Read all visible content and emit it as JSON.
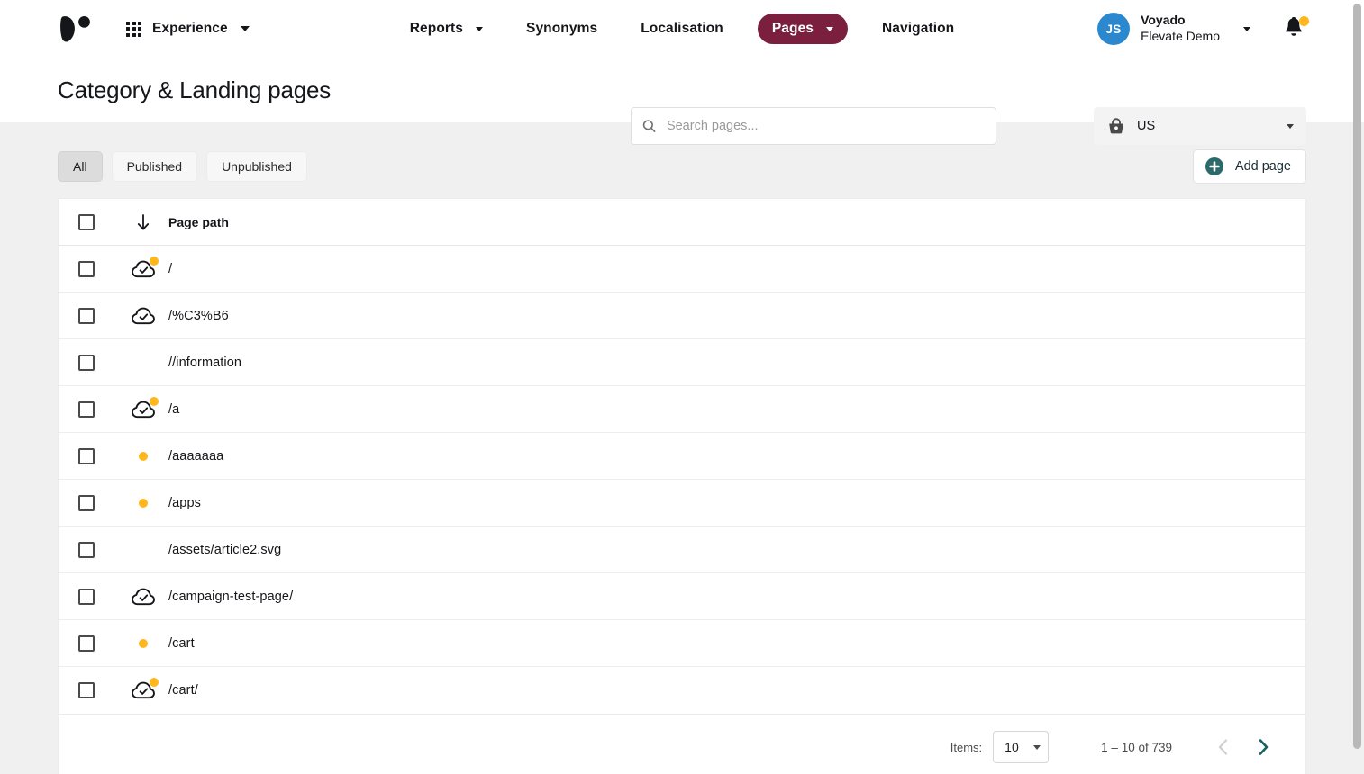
{
  "topbar": {
    "logo_name": "voyado-logo",
    "app_switcher": {
      "label": "Experience"
    },
    "nav": [
      {
        "label": "Reports",
        "has_caret": true,
        "active": false
      },
      {
        "label": "Synonyms",
        "has_caret": false,
        "active": false
      },
      {
        "label": "Localisation",
        "has_caret": false,
        "active": false
      },
      {
        "label": "Pages",
        "has_caret": true,
        "active": true
      },
      {
        "label": "Navigation",
        "has_caret": false,
        "active": false
      }
    ],
    "user": {
      "initials": "JS",
      "org": "Voyado",
      "account": "Elevate Demo",
      "avatar_color": "#2b87ce"
    },
    "notifications": {
      "has_badge": true,
      "badge_color": "#ffb71b"
    },
    "active_pill_color": "#7a1f3d"
  },
  "subheader": {
    "title": "Category & Landing pages",
    "search": {
      "placeholder": "Search pages...",
      "value": ""
    },
    "market": {
      "label": "US",
      "icon": "basket-icon"
    }
  },
  "toolbar": {
    "filters": [
      {
        "label": "All",
        "active": true
      },
      {
        "label": "Published",
        "active": false
      },
      {
        "label": "Unpublished",
        "active": false
      }
    ],
    "add_page_label": "Add page",
    "add_icon_color": "#2b6a6a"
  },
  "table": {
    "columns": [
      {
        "key": "checkbox",
        "label": ""
      },
      {
        "key": "status",
        "label": ""
      },
      {
        "key": "path",
        "label": "Page path",
        "sort": "desc"
      }
    ],
    "rows": [
      {
        "path": "/",
        "checked": false,
        "published": true,
        "changed": true
      },
      {
        "path": "/%C3%B6",
        "checked": false,
        "published": true,
        "changed": false
      },
      {
        "path": "//information",
        "checked": false,
        "published": false,
        "changed": false
      },
      {
        "path": "/a",
        "checked": false,
        "published": true,
        "changed": true
      },
      {
        "path": "/aaaaaaa",
        "checked": false,
        "published": false,
        "changed": true
      },
      {
        "path": "/apps",
        "checked": false,
        "published": false,
        "changed": true
      },
      {
        "path": "/assets/article2.svg",
        "checked": false,
        "published": false,
        "changed": false
      },
      {
        "path": "/campaign-test-page/",
        "checked": false,
        "published": true,
        "changed": false
      },
      {
        "path": "/cart",
        "checked": false,
        "published": false,
        "changed": true
      },
      {
        "path": "/cart/",
        "checked": false,
        "published": true,
        "changed": true
      }
    ]
  },
  "pagination": {
    "items_label": "Items:",
    "page_size": "10",
    "range_text": "1 – 10 of 739",
    "prev_enabled": false,
    "next_enabled": true
  }
}
